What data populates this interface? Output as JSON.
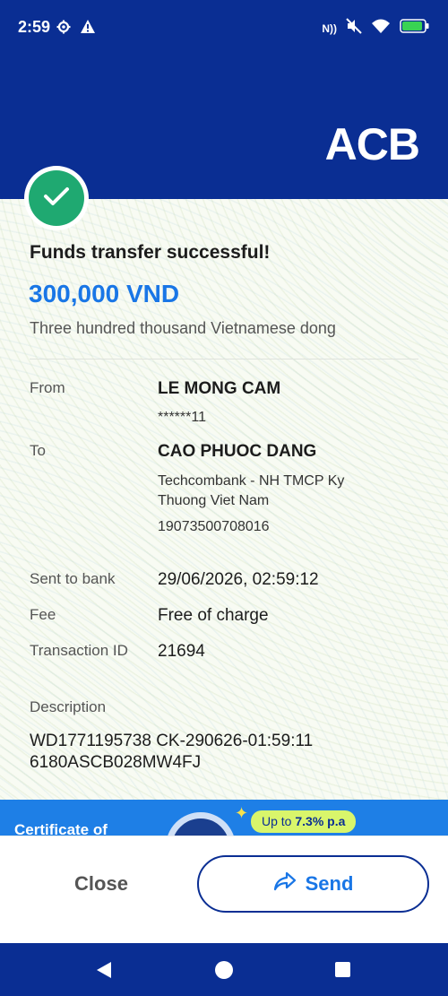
{
  "status_bar": {
    "time": "2:59",
    "nfc": "N))"
  },
  "brand": {
    "logo": "ACB"
  },
  "receipt": {
    "title": "Funds transfer successful!",
    "amount": "300,000 VND",
    "amount_words": "Three hundred thousand Vietnamese dong",
    "from": {
      "label": "From",
      "name": "LE MONG CAM",
      "account": "******11"
    },
    "to": {
      "label": "To",
      "name": "CAO PHUOC DANG",
      "bank_line1": "Techcombank - NH TMCP Ky",
      "bank_line2": "Thuong Viet Nam",
      "account": "19073500708016"
    },
    "sent_to_bank": {
      "label": "Sent to bank",
      "value": "29/06/2026, 02:59:12"
    },
    "fee": {
      "label": "Fee",
      "value": "Free of charge"
    },
    "transaction_id": {
      "label": "Transaction ID",
      "value": "21694"
    },
    "description": {
      "label": "Description",
      "line1": "WD1771195738 CK-290626-01:59:11",
      "line2": "6180ASCB028MW4FJ"
    }
  },
  "promo": {
    "text": "Certificate of",
    "badge_prefix": "Up to ",
    "badge_rate": "7.3% p.a"
  },
  "actions": {
    "close_label": "Close",
    "send_label": "Send"
  },
  "colors": {
    "brand_blue": "#0a2e93",
    "accent_blue": "#1976e6",
    "success_green": "#1fa971"
  },
  "icons": [
    "gear-icon",
    "warning-icon",
    "nfc-icon",
    "mute-icon",
    "wifi-icon",
    "battery-icon",
    "check-icon",
    "share-icon",
    "back-icon",
    "home-icon",
    "recents-icon"
  ]
}
